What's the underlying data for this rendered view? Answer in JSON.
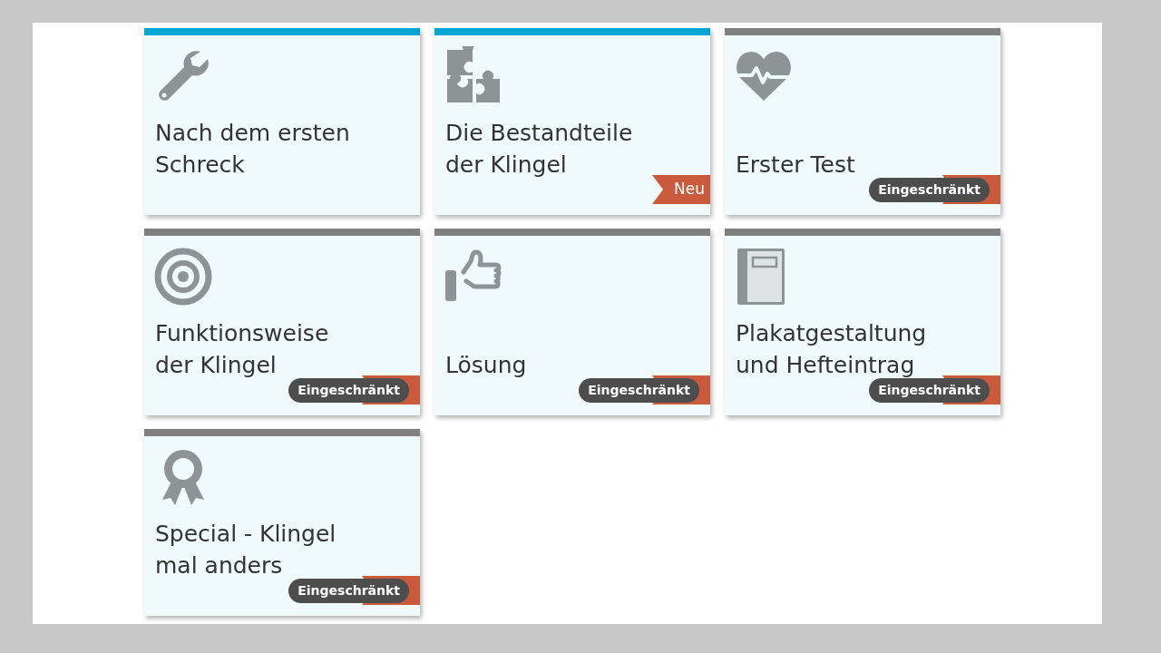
{
  "cards": [
    {
      "title": "Nach dem ersten Schreck",
      "color": "#00a5d2"
    },
    {
      "title": "Die Bestandteile der Klingel",
      "color": "#00a5d2",
      "badge": {
        "kind": "new",
        "label": "Neu"
      }
    },
    {
      "title": "Erster Test",
      "color": "#808080",
      "badge": {
        "kind": "restricted",
        "label": "Eingeschränkt"
      }
    },
    {
      "title": "Funktionsweise der Klingel",
      "color": "#808080",
      "badge": {
        "kind": "restricted",
        "label": "Eingeschränkt"
      }
    },
    {
      "title": "Lösung",
      "color": "#808080",
      "badge": {
        "kind": "restricted",
        "label": "Eingeschränkt"
      }
    },
    {
      "title": "Plakatgestaltung und Hefteintrag",
      "color": "#808080",
      "badge": {
        "kind": "restricted",
        "label": "Eingeschränkt"
      }
    },
    {
      "title": "Special - Klingel mal anders",
      "color": "#808080",
      "badge": {
        "kind": "restricted",
        "label": "Eingeschränkt"
      }
    }
  ]
}
